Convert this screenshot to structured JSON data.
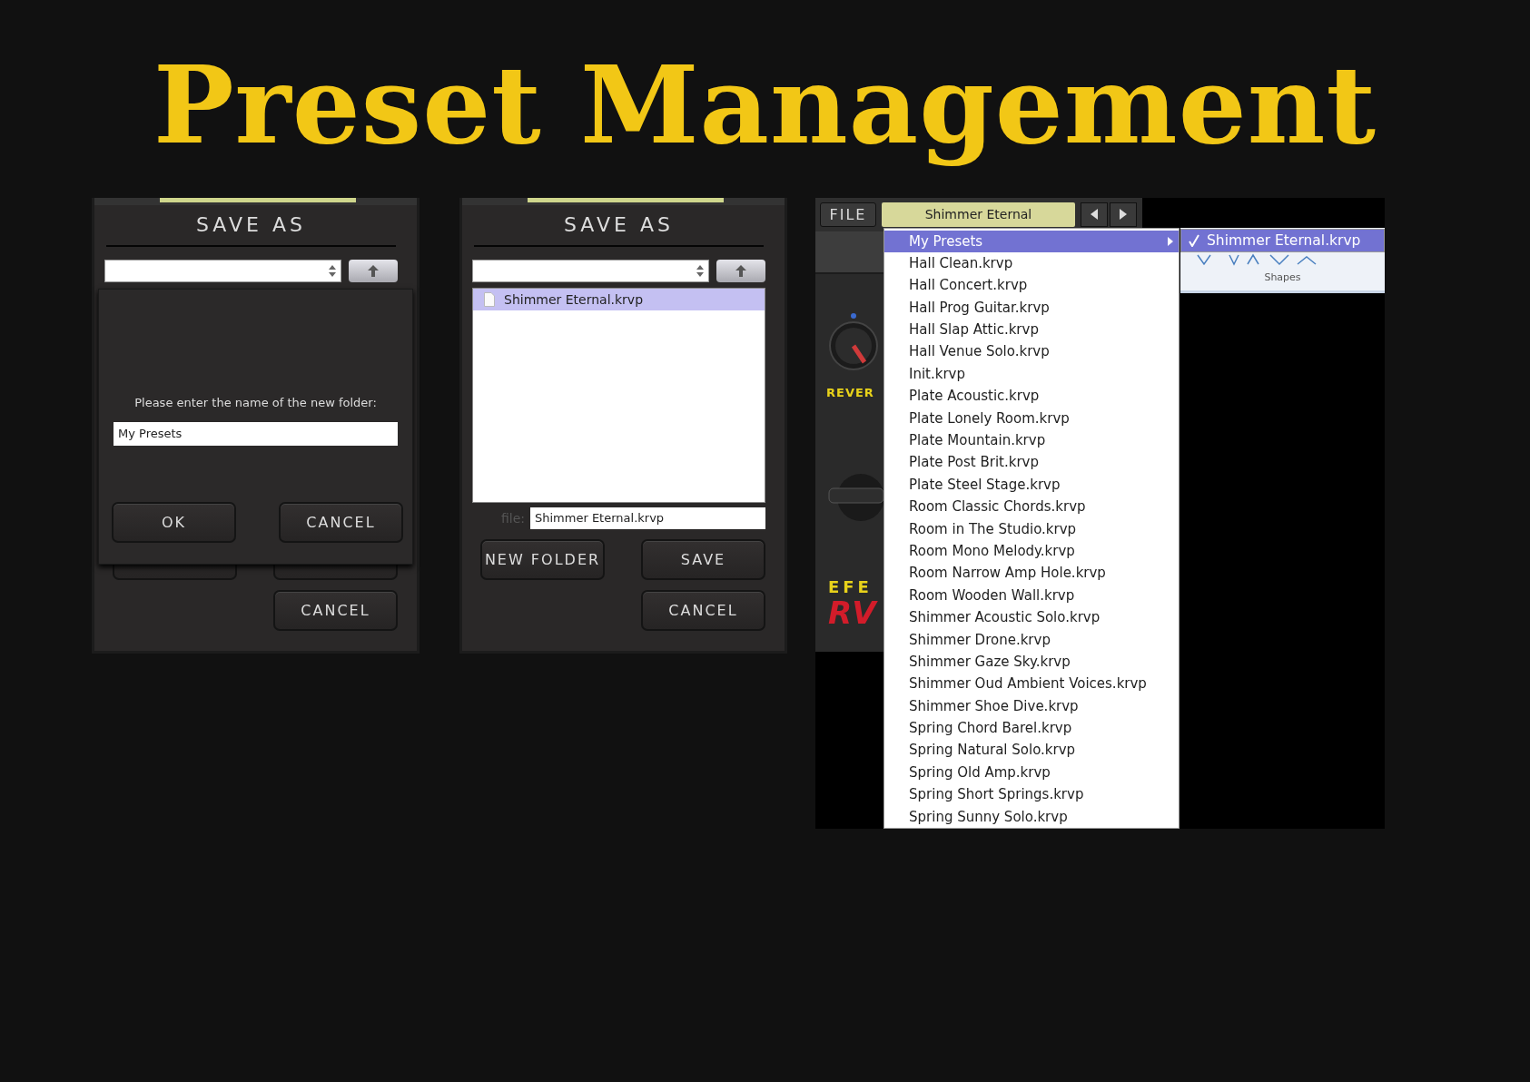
{
  "title": "Preset Management",
  "dialogs": [
    {
      "kind": "new_folder",
      "title": "SAVE AS",
      "prompt": "Please enter the name of the new folder:",
      "folder_name": "My Presets",
      "ok": "OK",
      "cancel_overlay": "CANCEL",
      "cancel": "CANCEL"
    },
    {
      "kind": "save",
      "title": "SAVE AS",
      "files": [
        {
          "name": "Shimmer Eternal.krvp",
          "selected": true
        }
      ],
      "file_label": "file:",
      "file_name": "Shimmer Eternal.krvp",
      "new_folder": "NEW FOLDER",
      "save": "SAVE",
      "cancel": "CANCEL"
    }
  ],
  "plugin": {
    "file_button": "FILE",
    "preset": "Shimmer Eternal",
    "knob_label": "REVER",
    "brand": "EFE",
    "model": "RV"
  },
  "menu": {
    "items": [
      {
        "label": "My Presets",
        "kind": "folder",
        "selected": true
      },
      {
        "label": "Hall Clean.krvp",
        "kind": "file",
        "selected": false
      },
      {
        "label": "Hall Concert.krvp",
        "kind": "file",
        "selected": false
      },
      {
        "label": "Hall Prog Guitar.krvp",
        "kind": "file",
        "selected": false
      },
      {
        "label": "Hall Slap Attic.krvp",
        "kind": "file",
        "selected": false
      },
      {
        "label": "Hall Venue Solo.krvp",
        "kind": "file",
        "selected": false
      },
      {
        "label": "Init.krvp",
        "kind": "file",
        "selected": false
      },
      {
        "label": "Plate Acoustic.krvp",
        "kind": "file",
        "selected": false
      },
      {
        "label": "Plate Lonely Room.krvp",
        "kind": "file",
        "selected": false
      },
      {
        "label": "Plate Mountain.krvp",
        "kind": "file",
        "selected": false
      },
      {
        "label": "Plate Post Brit.krvp",
        "kind": "file",
        "selected": false
      },
      {
        "label": "Plate Steel Stage.krvp",
        "kind": "file",
        "selected": false
      },
      {
        "label": "Room Classic Chords.krvp",
        "kind": "file",
        "selected": false
      },
      {
        "label": "Room in The Studio.krvp",
        "kind": "file",
        "selected": false
      },
      {
        "label": "Room Mono Melody.krvp",
        "kind": "file",
        "selected": false
      },
      {
        "label": "Room Narrow Amp Hole.krvp",
        "kind": "file",
        "selected": false
      },
      {
        "label": "Room Wooden Wall.krvp",
        "kind": "file",
        "selected": false
      },
      {
        "label": "Shimmer Acoustic Solo.krvp",
        "kind": "file",
        "selected": false
      },
      {
        "label": "Shimmer Drone.krvp",
        "kind": "file",
        "selected": false
      },
      {
        "label": "Shimmer Gaze Sky.krvp",
        "kind": "file",
        "selected": false
      },
      {
        "label": "Shimmer Oud Ambient Voices.krvp",
        "kind": "file",
        "selected": false
      },
      {
        "label": "Shimmer Shoe Dive.krvp",
        "kind": "file",
        "selected": false
      },
      {
        "label": "Spring Chord Barel.krvp",
        "kind": "file",
        "selected": false
      },
      {
        "label": "Spring Natural Solo.krvp",
        "kind": "file",
        "selected": false
      },
      {
        "label": "Spring Old Amp.krvp",
        "kind": "file",
        "selected": false
      },
      {
        "label": "Spring Short Springs.krvp",
        "kind": "file",
        "selected": false
      },
      {
        "label": "Spring Sunny Solo.krvp",
        "kind": "file",
        "selected": false
      }
    ]
  },
  "submenu": {
    "items": [
      {
        "label": "Shimmer Eternal.krvp",
        "checked": true
      }
    ]
  },
  "ribbon": {
    "label": "Shapes"
  }
}
